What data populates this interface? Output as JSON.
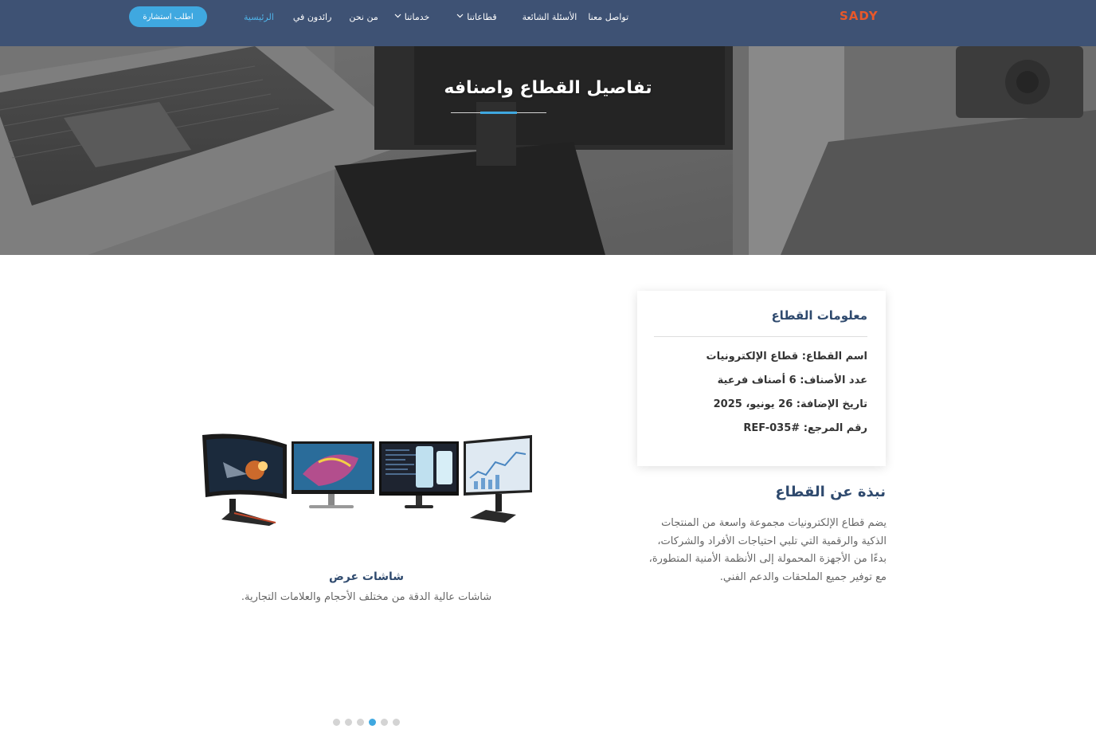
{
  "navbar": {
    "logo": "SADY",
    "items": [
      {
        "label": "الرئيسية",
        "active": true,
        "dropdown": false
      },
      {
        "label": "رائدون في",
        "active": false,
        "dropdown": false
      },
      {
        "label": "من نحن",
        "active": false,
        "dropdown": false
      },
      {
        "label": "خدماتنا",
        "active": false,
        "dropdown": true
      },
      {
        "label": "قطاعاتنا",
        "active": false,
        "dropdown": true
      },
      {
        "label": "الأسئلة الشائعة",
        "active": false,
        "dropdown": false
      },
      {
        "label": "تواصل معنا",
        "active": false,
        "dropdown": false
      }
    ],
    "cta_label": "اطلب استشارة",
    "accent_color": "#3fa8e0",
    "bg_color": "#3e5274",
    "logo_color": "#e8582a"
  },
  "hero": {
    "title": "تفاصيل القطاع واصنافه"
  },
  "info_card": {
    "title": "معلومات القطاع",
    "rows": [
      {
        "label": "اسم القطاع:",
        "value": "قطاع الإلكترونيات"
      },
      {
        "label": "عدد الأصناف:",
        "value": "6 أصناف فرعية"
      },
      {
        "label": "تاريخ الإضافة:",
        "value": "26 يونيو، 2025"
      },
      {
        "label": "رقم المرجع:",
        "value": "REF-035#"
      }
    ]
  },
  "about": {
    "title": "نبذة عن القطاع",
    "text": "يضم قطاع الإلكترونيات مجموعة واسعة من المنتجات الذكية والرقمية التي تلبي احتياجات الأفراد والشركات، بدءًا من الأجهزة المحمولة إلى الأنظمة الأمنية المتطورة، مع توفير جميع الملحقات والدعم الفني."
  },
  "slider": {
    "slide_title": "شاشات عرض",
    "slide_description": "شاشات عالية الدقة من مختلف الأحجام والعلامات التجارية.",
    "dot_count": 6,
    "active_dot": 4
  }
}
